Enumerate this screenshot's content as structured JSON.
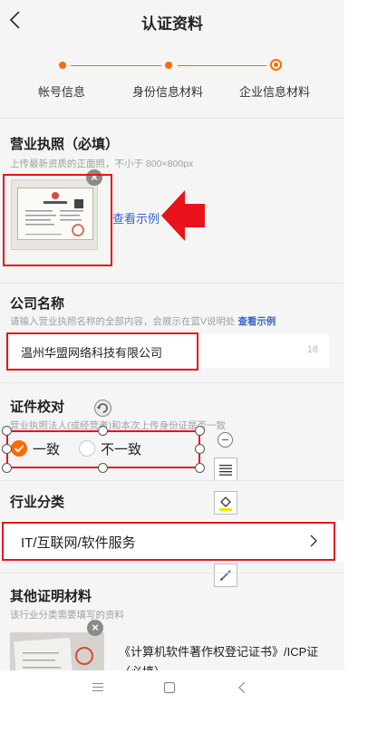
{
  "header": {
    "title": "认证资料"
  },
  "steps": [
    {
      "label": "帐号信息"
    },
    {
      "label": "身份信息材料"
    },
    {
      "label": "企业信息材料"
    }
  ],
  "license": {
    "title": "营业执照（必填）",
    "hint": "上传最新资质的正面照，不小于 800×800px",
    "view_example": "查看示例"
  },
  "company": {
    "title": "公司名称",
    "hint": "请输入营业执照名称的全部内容，会展示在蓝V说明处",
    "hint_link": "查看示例",
    "value": "温州华盟网络科技有限公司",
    "char_count": "18"
  },
  "verify": {
    "title": "证件校对",
    "hint": "营业执照法人(或经营者)和本次上传身份证是否一致",
    "option_yes": "一致",
    "option_no": "不一致"
  },
  "industry": {
    "title": "行业分类",
    "value": "IT/互联网/软件服务"
  },
  "other_docs": {
    "title": "其他证明材料",
    "hint": "该行业分类需要填写的资料",
    "doc_name": "《计算机软件著作权登记证书》/ICP证（必填）"
  },
  "colors": {
    "accent": "#ff6a00",
    "link": "#3a63c6",
    "annotation": "#e8131b"
  }
}
